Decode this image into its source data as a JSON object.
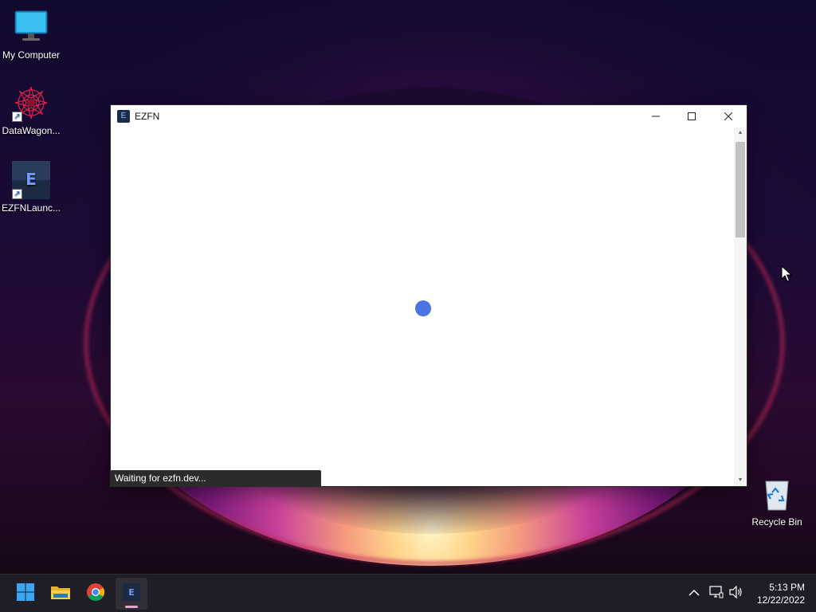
{
  "desktop": {
    "icons": [
      {
        "label": "My Computer"
      },
      {
        "label": "DataWagon..."
      },
      {
        "label": "EZFNLaunc..."
      },
      {
        "label": "Recycle Bin"
      }
    ]
  },
  "window": {
    "title": "EZFN",
    "app_icon_glyph": "E",
    "status_text": "Waiting for ezfn.dev...",
    "spinner_color": "#4a74e0"
  },
  "taskbar": {
    "apps": [
      {
        "name": "start",
        "icon": "windows-logo-icon"
      },
      {
        "name": "file-explorer",
        "icon": "folder-icon"
      },
      {
        "name": "chrome",
        "icon": "chrome-icon"
      },
      {
        "name": "ezfn-launcher",
        "icon": "ezfn-app-icon",
        "active": true
      }
    ],
    "time": "5:13 PM",
    "date": "12/22/2022"
  }
}
